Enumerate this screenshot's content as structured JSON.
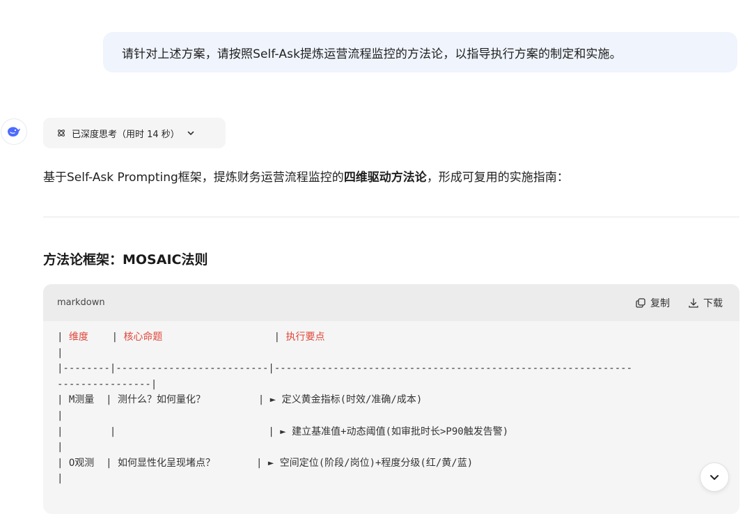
{
  "user_message": "请针对上述方案，请按照Self-Ask提炼运营流程监控的方法论，以指导执行方案的制定和实施。",
  "assistant": {
    "avatar_icon": "deepseek-whale-icon",
    "think_chip": {
      "label": "已深度思考（用时 14 秒）"
    },
    "intro": {
      "part1": "基于Self-Ask Prompting框架，提炼财务运营流程监控的",
      "bold": "四维驱动方法论",
      "part2": "，形成可复用的实施指南："
    },
    "section_title": "方法论框架：MOSAIC法则",
    "code_block": {
      "language": "markdown",
      "copy_label": "复制",
      "download_label": "下载",
      "header_cols": [
        "维度",
        "核心命题",
        "执行要点"
      ],
      "lines": [
        "|",
        "|--------|--------------------------|-------------------------------------------------------------",
        "----------------|",
        "| M测量  | 测什么？如何量化？         | ► 定义黄金指标(时效/准确/成本)",
        "|",
        "|        |                          | ► 建立基准值+动态阈值(如审批时长>P90触发告警)",
        "|",
        "| O观测  | 如何显性化呈现堵点？       | ► 空间定位(阶段/岗位)+程度分级(红/黄/蓝)",
        "|"
      ]
    }
  },
  "colors": {
    "accent_red": "#e0473b",
    "user_bubble": "#eff4fd",
    "brand_blue": "#4d6bfe"
  }
}
